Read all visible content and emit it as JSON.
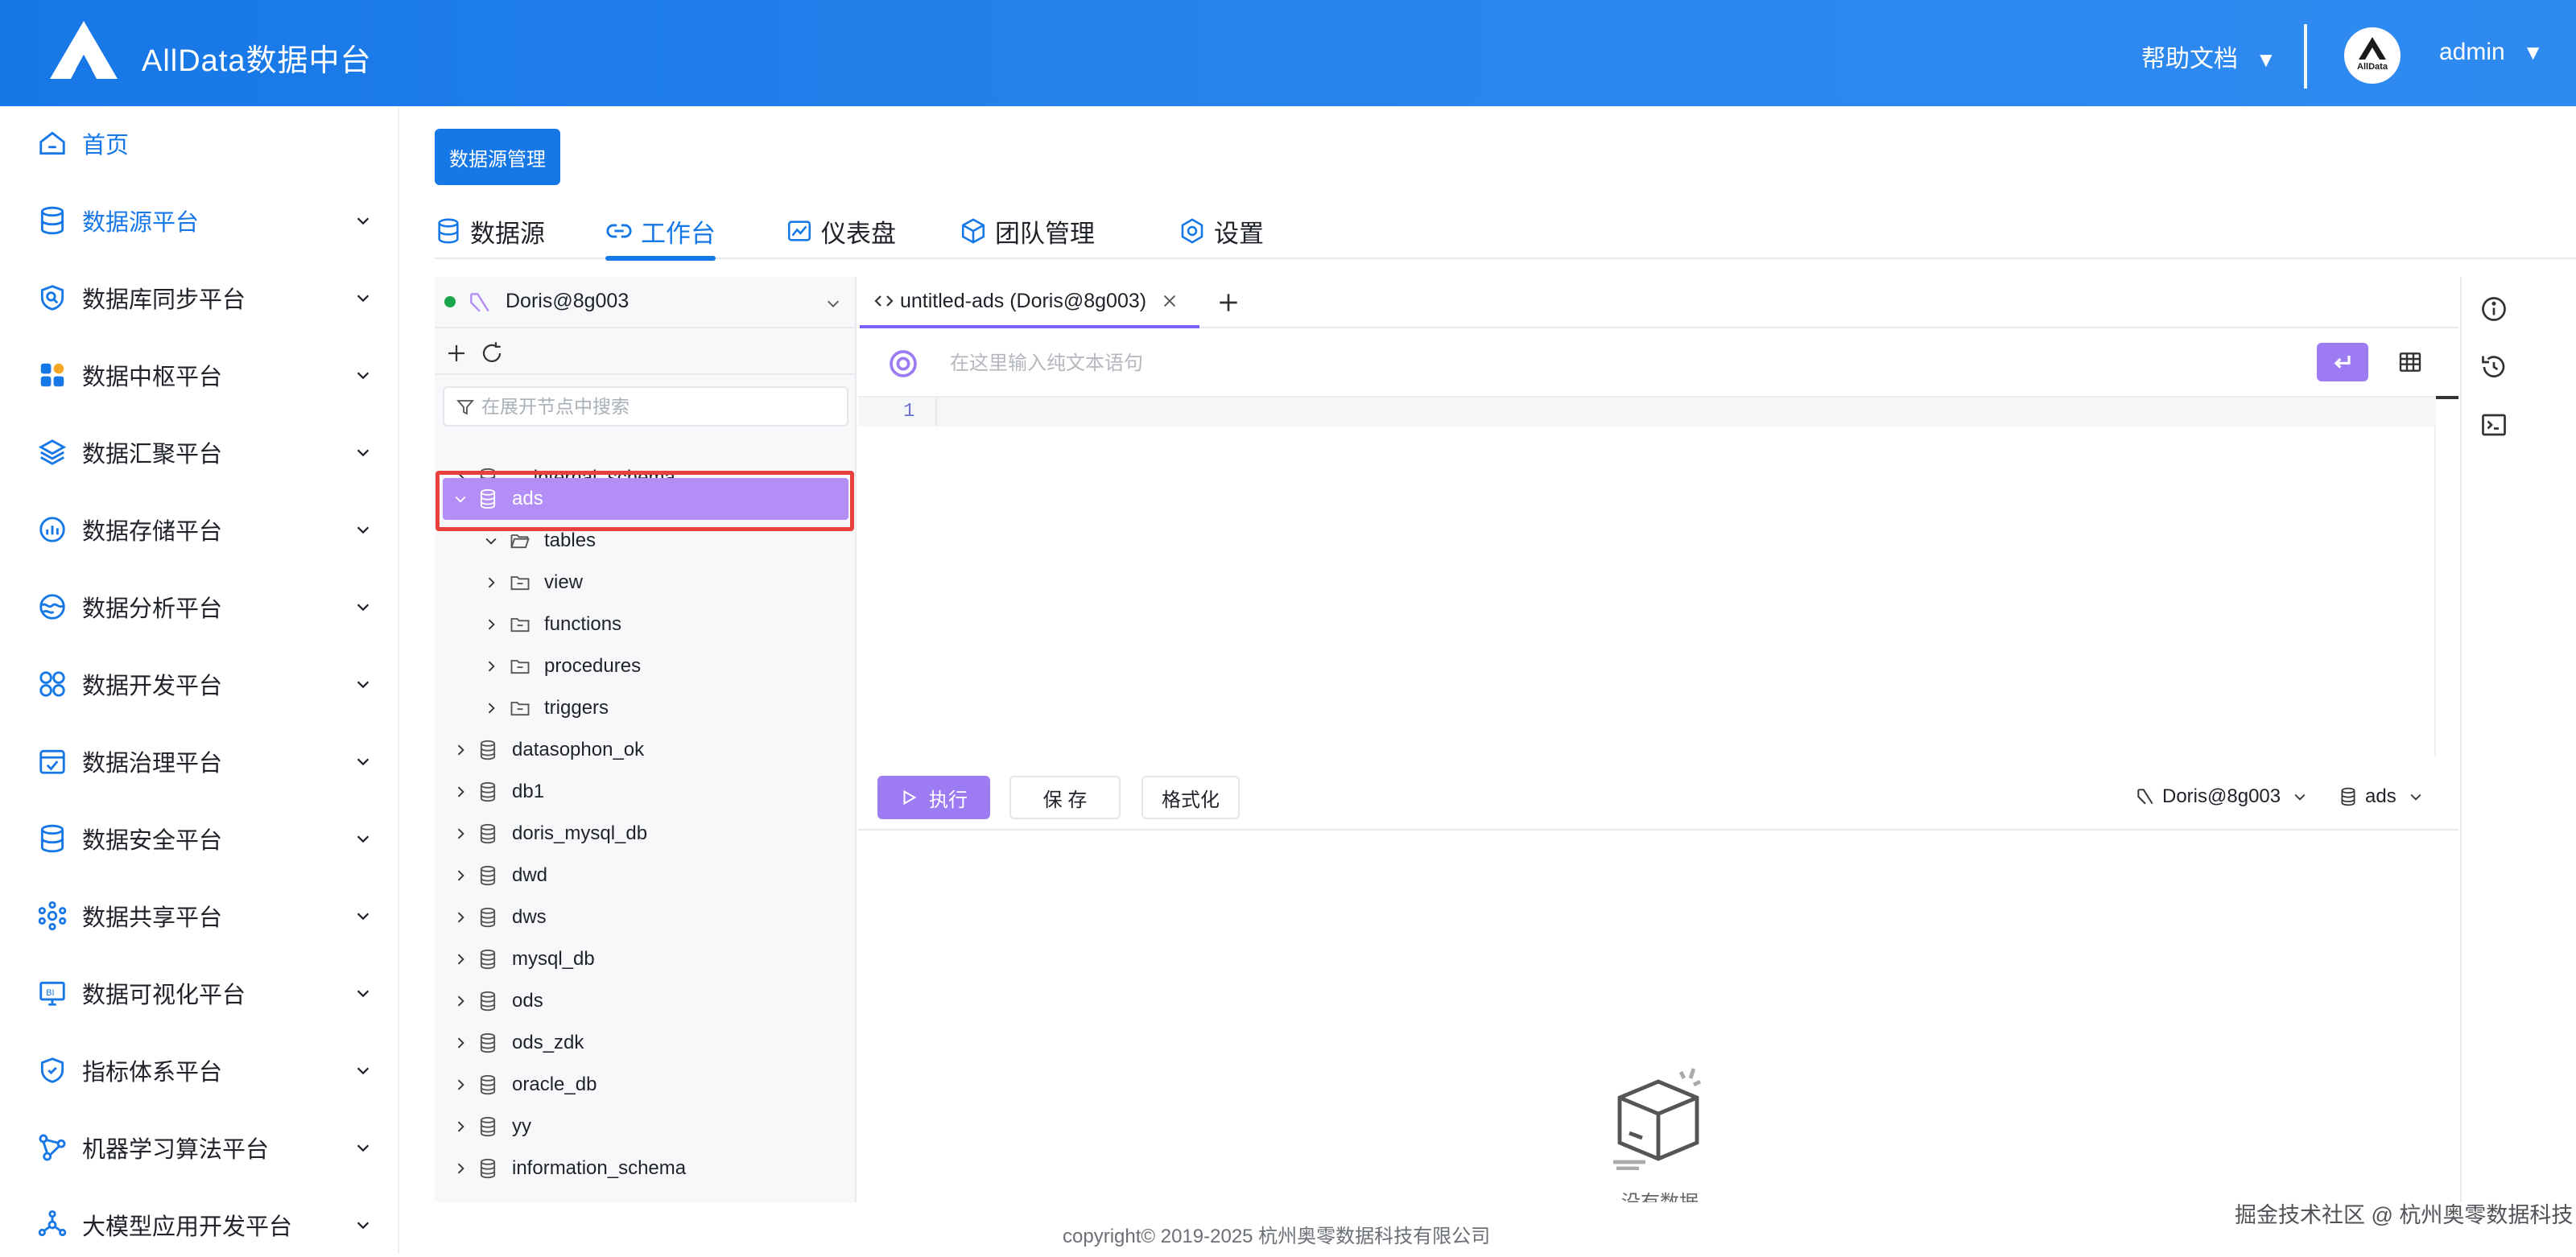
{
  "header": {
    "app_title": "AllData数据中台",
    "help_label": "帮助文档",
    "user_name": "admin",
    "avatar_text": "AllData"
  },
  "sidebar": {
    "items": [
      {
        "label": "首页",
        "icon": "home-icon"
      },
      {
        "label": "数据源平台",
        "icon": "database-icon"
      },
      {
        "label": "数据库同步平台",
        "icon": "sync-icon"
      },
      {
        "label": "数据中枢平台",
        "icon": "hub-icon"
      },
      {
        "label": "数据汇聚平台",
        "icon": "layers-icon"
      },
      {
        "label": "数据存储平台",
        "icon": "storage-icon"
      },
      {
        "label": "数据分析平台",
        "icon": "analysis-icon"
      },
      {
        "label": "数据开发平台",
        "icon": "dev-icon"
      },
      {
        "label": "数据治理平台",
        "icon": "governance-icon"
      },
      {
        "label": "数据安全平台",
        "icon": "security-icon"
      },
      {
        "label": "数据共享平台",
        "icon": "share-icon"
      },
      {
        "label": "数据可视化平台",
        "icon": "bi-icon"
      },
      {
        "label": "指标体系平台",
        "icon": "metric-icon"
      },
      {
        "label": "机器学习算法平台",
        "icon": "ml-icon"
      },
      {
        "label": "大模型应用开发平台",
        "icon": "llm-icon"
      }
    ]
  },
  "main": {
    "datasource_btn": "数据源管理",
    "tabs": [
      {
        "label": "数据源",
        "icon": "database-icon"
      },
      {
        "label": "工作台",
        "icon": "link-icon",
        "active": true
      },
      {
        "label": "仪表盘",
        "icon": "chart-icon"
      },
      {
        "label": "团队管理",
        "icon": "cube-icon"
      },
      {
        "label": "设置",
        "icon": "gear-icon"
      }
    ]
  },
  "explorer": {
    "connection": "Doris@8g003",
    "search_placeholder": "在展开节点中搜索",
    "tree": [
      {
        "label": "__internal_schema",
        "level": 0,
        "type": "db",
        "expanded": false
      },
      {
        "label": "ads",
        "level": 0,
        "type": "db",
        "expanded": true,
        "selected": true
      },
      {
        "label": "tables",
        "level": 1,
        "type": "folder-open",
        "expanded": true
      },
      {
        "label": "view",
        "level": 1,
        "type": "folder",
        "expanded": false
      },
      {
        "label": "functions",
        "level": 1,
        "type": "folder",
        "expanded": false
      },
      {
        "label": "procedures",
        "level": 1,
        "type": "folder",
        "expanded": false
      },
      {
        "label": "triggers",
        "level": 1,
        "type": "folder",
        "expanded": false
      },
      {
        "label": "datasophon_ok",
        "level": 0,
        "type": "db",
        "expanded": false
      },
      {
        "label": "db1",
        "level": 0,
        "type": "db",
        "expanded": false
      },
      {
        "label": "doris_mysql_db",
        "level": 0,
        "type": "db",
        "expanded": false
      },
      {
        "label": "dwd",
        "level": 0,
        "type": "db",
        "expanded": false
      },
      {
        "label": "dws",
        "level": 0,
        "type": "db",
        "expanded": false
      },
      {
        "label": "mysql_db",
        "level": 0,
        "type": "db",
        "expanded": false
      },
      {
        "label": "ods",
        "level": 0,
        "type": "db",
        "expanded": false
      },
      {
        "label": "ods_zdk",
        "level": 0,
        "type": "db",
        "expanded": false
      },
      {
        "label": "oracle_db",
        "level": 0,
        "type": "db",
        "expanded": false
      },
      {
        "label": "yy",
        "level": 0,
        "type": "db",
        "expanded": false
      },
      {
        "label": "information_schema",
        "level": 0,
        "type": "db",
        "expanded": false
      }
    ]
  },
  "editor": {
    "tab_label": "untitled-ads (Doris@8g003)",
    "nl_placeholder": "在这里输入纯文本语句",
    "line_number": "1",
    "run_label": "执行",
    "save_label": "保 存",
    "format_label": "格式化",
    "conn_label": "Doris@8g003",
    "db_label": "ads",
    "empty_text": "没有数据"
  },
  "footer": {
    "copyright": "copyright© 2019-2025 杭州奥零数据科技有限公司",
    "watermark": "掘金技术社区 @ 杭州奥零数据科技"
  },
  "colors": {
    "brand_blue": "#1677e6",
    "selected_purple": "#b38ef7",
    "button_purple": "#9d7bf3",
    "highlight_red": "#e8413d"
  }
}
